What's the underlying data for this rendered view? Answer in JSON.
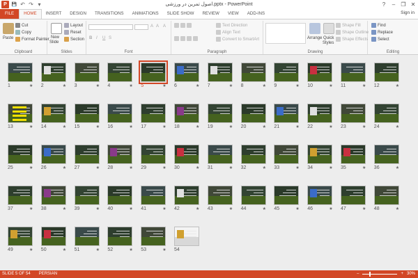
{
  "window": {
    "title": "اصول تمرین در ورزشی.pptx - PowerPoint",
    "app_icon": "P",
    "minimize": "–",
    "restore": "❐",
    "close": "✕",
    "help": "?"
  },
  "qat": {
    "save": "💾",
    "undo": "↶",
    "redo": "↷",
    "customize": "▾"
  },
  "tabs": [
    "FILE",
    "HOME",
    "INSERT",
    "DESIGN",
    "TRANSITIONS",
    "ANIMATIONS",
    "SLIDE SHOW",
    "REVIEW",
    "VIEW",
    "ADD-INS"
  ],
  "active_tab": "HOME",
  "signin": "Sign in",
  "ribbon": {
    "clipboard": {
      "label": "Clipboard",
      "paste": "Paste",
      "cut": "Cut",
      "copy": "Copy",
      "format_painter": "Format Painter"
    },
    "slides": {
      "label": "Slides",
      "new_slide": "New",
      "new_slide_2": "Slide",
      "layout": "Layout",
      "reset": "Reset",
      "section": "Section"
    },
    "font": {
      "label": "Font",
      "bold": "B",
      "italic": "I",
      "underline": "U",
      "strike": "S",
      "grow": "A",
      "shrink": "A",
      "clear": "A"
    },
    "paragraph": {
      "label": "Paragraph",
      "text_direction": "Text Direction",
      "align_text": "Align Text",
      "convert_smartart": "Convert to SmartArt"
    },
    "drawing": {
      "label": "Drawing",
      "arrange": "Arrange",
      "quick_styles": "Quick",
      "quick_styles_2": "Styles",
      "shape_fill": "Shape Fill",
      "shape_outline": "Shape Outline",
      "shape_effects": "Shape Effects"
    },
    "editing": {
      "label": "Editing",
      "find": "Find",
      "replace": "Replace",
      "select": "Select"
    }
  },
  "slides": {
    "count": 54,
    "selected": 5
  },
  "status": {
    "slide_info": "SLIDE 5 OF 54",
    "language": "PERSIAN",
    "zoom": "30%",
    "zoom_minus": "–",
    "zoom_plus": "+"
  },
  "colors": {
    "accent": "#d24726",
    "ribbon_bg": "#f7f7f7",
    "canvas_bg": "#ededed"
  }
}
